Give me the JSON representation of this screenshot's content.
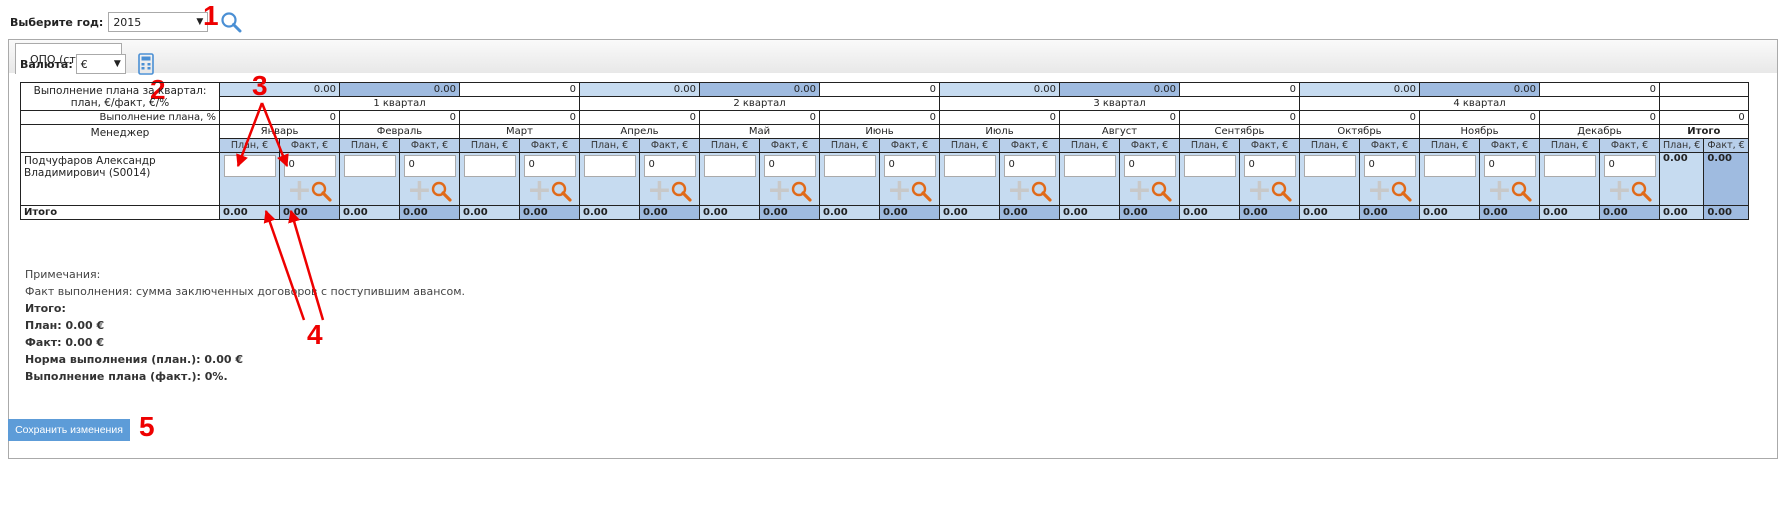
{
  "top": {
    "year_label": "Выберите год:",
    "year_value": "2015"
  },
  "tab": {
    "label": "ОПО (стекло)"
  },
  "currency": {
    "label": "Валюта:",
    "value": "€"
  },
  "annotations": [
    "1",
    "2",
    "3",
    "4",
    "5"
  ],
  "rows": {
    "exec_label": "Выполнение плана за квартал: план, €/факт, €/%",
    "quarters": [
      {
        "name": "1 квартал",
        "plan": "0.00",
        "fact": "0.00",
        "pct": "0"
      },
      {
        "name": "2 квартал",
        "plan": "0.00",
        "fact": "0.00",
        "pct": "0"
      },
      {
        "name": "3 квартал",
        "plan": "0.00",
        "fact": "0.00",
        "pct": "0"
      },
      {
        "name": "4 квартал",
        "plan": "0.00",
        "fact": "0.00",
        "pct": "0"
      }
    ],
    "pct_label": "Выполнение плана, %",
    "manager_label": "Менеджер",
    "months": [
      "Январь",
      "Февраль",
      "Март",
      "Апрель",
      "Май",
      "Июнь",
      "Июль",
      "Август",
      "Сентябрь",
      "Октябрь",
      "Ноябрь",
      "Декабрь"
    ],
    "month_pct": [
      "0",
      "0",
      "0",
      "0",
      "0",
      "0",
      "0",
      "0",
      "0",
      "0",
      "0",
      "0"
    ],
    "total_label": "Итого",
    "plan_hdr": "План, €",
    "fact_hdr": "Факт, €",
    "manager_name": "Подчуфаров Александр Владимирович (S0014)",
    "fact_input": "0",
    "row_total_plan": "0.00",
    "row_total_fact": "0.00",
    "footer_label": "Итого",
    "footer_value": "0.00"
  },
  "notes": {
    "title": "Примечания:",
    "fact_def": "Факт выполнения: сумма заключенных договоров с поступившим авансом.",
    "total": "Итого:",
    "plan": "План: 0.00 €",
    "fact": "Факт: 0.00 €",
    "norm": "Норма выполнения (план.): 0.00 €",
    "exec": "Выполнение плана (факт.): 0%."
  },
  "save_button": "Сохранить изменения",
  "colors": {
    "accent": "#5d9cd8",
    "cell_light": "#c6dbf0",
    "cell_dark": "#9fbbe0",
    "annotation": "#e00000"
  }
}
